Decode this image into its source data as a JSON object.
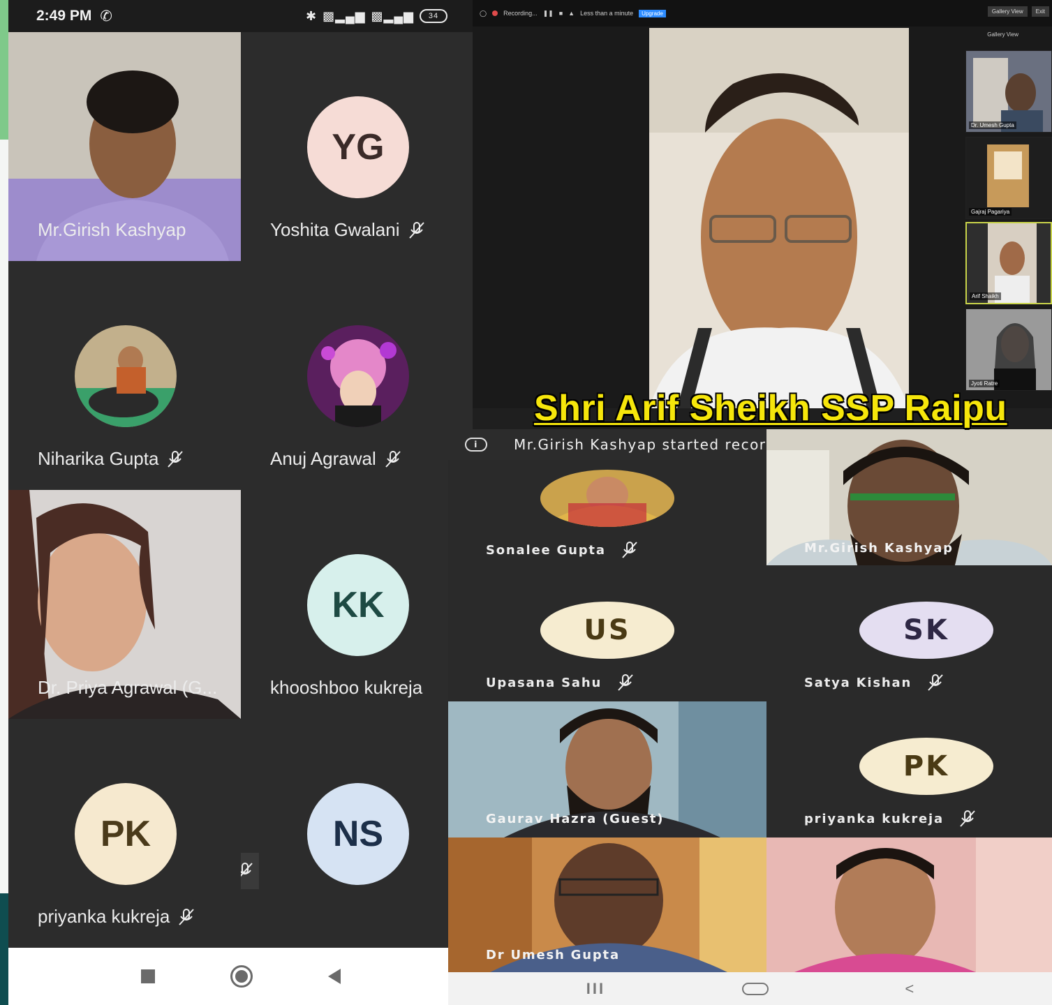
{
  "left_phone": {
    "status_bar": {
      "time": "2:49 PM",
      "battery": "34"
    },
    "participants": [
      {
        "name": "Mr.Girish   Kashyap",
        "type": "video",
        "muted": false
      },
      {
        "name": "Yoshita Gwalani",
        "type": "initials",
        "initials": "YG",
        "color": "#f6dcd6",
        "text_color": "#3a2a28",
        "muted": true
      },
      {
        "name": "Niharika Gupta",
        "type": "photo",
        "muted": true
      },
      {
        "name": "Anuj Agrawal",
        "type": "photo",
        "muted": true
      },
      {
        "name": "Dr. Priya Agrawal (G...",
        "type": "video",
        "muted": false
      },
      {
        "name": "khooshboo kukreja",
        "type": "initials",
        "initials": "KK",
        "color": "#d7f0ec",
        "text_color": "#1d4a43",
        "muted": false
      },
      {
        "name": "priyanka kukreja",
        "type": "initials",
        "initials": "PK",
        "color": "#f6e9cf",
        "text_color": "#4a3a1a",
        "muted": true
      },
      {
        "name": "",
        "type": "initials",
        "initials": "NS",
        "color": "#d6e3f3",
        "text_color": "#1c2f49",
        "muted": true
      }
    ]
  },
  "zoom_desktop": {
    "recording_label": "Recording...",
    "warning_label": "Less than a minute",
    "upgrade_label": "Upgrade",
    "gallery_view_button": "Gallery View",
    "exit_button": "Exit",
    "gallery_view_label": "Gallery View",
    "thumbnails": [
      {
        "name": "Dr. Umesh Gupta"
      },
      {
        "name": "Gajraj Pagariya"
      },
      {
        "name": "Arif Shaikh"
      },
      {
        "name": "Jyoti Ratre"
      }
    ]
  },
  "caption": "Shri Arif Sheikh SSP Raipu",
  "right_phone": {
    "recording_notice": "Mr.Girish Kashyap started recording",
    "participants": [
      {
        "name": "Sonalee  Gupta",
        "type": "photo",
        "muted": true
      },
      {
        "name": "Mr.Girish   Kashyap",
        "type": "video",
        "muted": false
      },
      {
        "name": "Upasana Sahu",
        "type": "initials",
        "initials": "US",
        "color": "#f6ecd0",
        "text_color": "#4a3a14",
        "muted": true
      },
      {
        "name": "Satya Kishan",
        "type": "initials",
        "initials": "SK",
        "color": "#e4def1",
        "text_color": "#2e2744",
        "muted": true
      },
      {
        "name": "Gaurav Hazra (Guest)",
        "type": "video",
        "muted": false
      },
      {
        "name": "priyanka kukreja",
        "type": "initials",
        "initials": "PK",
        "color": "#f6ecd0",
        "text_color": "#4a3a14",
        "muted": true
      },
      {
        "name": "Dr Umesh  Gupta",
        "type": "video",
        "muted": false
      },
      {
        "name": "",
        "type": "video",
        "muted": false
      }
    ],
    "nav": {
      "recents": "III",
      "back": "<"
    }
  },
  "colors": {
    "yellow_caption": "#f6e60b",
    "tile_bg": "#2c2c2c",
    "dark_bg": "#252525"
  },
  "icons": [
    "phone-icon",
    "bluetooth-icon",
    "signal-icon",
    "battery-icon",
    "mic-off-icon",
    "info-icon",
    "recording-icon"
  ]
}
